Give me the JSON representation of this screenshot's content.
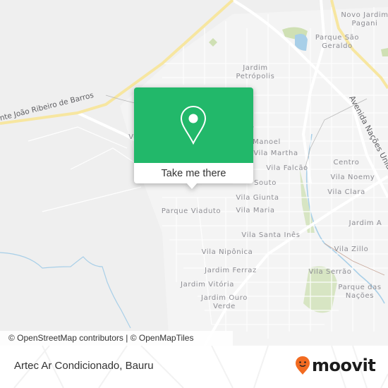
{
  "map": {
    "road_labels": [
      {
        "text": "nte João Ribeiro de Barros",
        "name": "road-label-joao-ribeiro-de-barros"
      },
      {
        "text": "Avenida Nações Unidas",
        "name": "road-label-avenida-nacoes-unidas"
      }
    ],
    "places": [
      {
        "name": "Novo Jardim Pagani",
        "lines": [
          "Novo Jardim",
          "Pagani"
        ]
      },
      {
        "name": "Parque São Geraldo",
        "lines": [
          "Parque São",
          "Geraldo"
        ]
      },
      {
        "name": "Jardim Petrópolis",
        "lines": [
          "Jardim",
          "Petrópolis"
        ]
      },
      {
        "name": "Manoel",
        "lines": [
          "Manoel"
        ]
      },
      {
        "name": "Vila Martha",
        "lines": [
          "Vila Martha"
        ]
      },
      {
        "name": "Vila Falcão",
        "lines": [
          "Vila Falcão"
        ]
      },
      {
        "name": "Souto",
        "lines": [
          "Souto"
        ]
      },
      {
        "name": "Centro",
        "lines": [
          "Centro"
        ]
      },
      {
        "name": "Vila Noemy",
        "lines": [
          "Vila Noemy"
        ]
      },
      {
        "name": "Vila Clara",
        "lines": [
          "Vila Clara"
        ]
      },
      {
        "name": "Vila Giunta",
        "lines": [
          "Vila Giunta"
        ]
      },
      {
        "name": "Parque Viaduto",
        "lines": [
          "Parque Viaduto"
        ]
      },
      {
        "name": "Vila Maria",
        "lines": [
          "Vila Maria"
        ]
      },
      {
        "name": "Vila Santa Inês",
        "lines": [
          "Vila Santa Inês"
        ]
      },
      {
        "name": "Jardim A",
        "lines": [
          "Jardim A"
        ]
      },
      {
        "name": "Vila Zillo",
        "lines": [
          "Vila Zillo"
        ]
      },
      {
        "name": "Vila Nipônica",
        "lines": [
          "Vila Nipônica"
        ]
      },
      {
        "name": "Vila Serrão",
        "lines": [
          "Vila Serrão"
        ]
      },
      {
        "name": "Jardim Ferraz",
        "lines": [
          "Jardim Ferraz"
        ]
      },
      {
        "name": "Parque das Nações",
        "lines": [
          "Parque das",
          "Nações"
        ]
      },
      {
        "name": "Jardim Vitória",
        "lines": [
          "Jardim Vitória"
        ]
      },
      {
        "name": "Jardim Ouro Verde",
        "lines": [
          "Jardim Ouro",
          "Verde"
        ]
      },
      {
        "name": "V",
        "lines": [
          "V"
        ]
      }
    ],
    "colors": {
      "background": "#efefef",
      "road_minor": "#ffffff",
      "road_major": "#f7e6a0",
      "water": "#a8cfe8",
      "park": "#cfe0b4"
    }
  },
  "popup": {
    "button_label": "Take me there",
    "icon": "map-pin-icon",
    "accent_color": "#22b86a"
  },
  "attribution": {
    "text": "© OpenStreetMap contributors | © OpenMapTiles"
  },
  "footer": {
    "title": "Artec Ar Condicionado, Bauru",
    "logo_text": "moovit",
    "logo_icon": "moovit-smiley-pin-icon",
    "logo_color": "#f26b21"
  }
}
